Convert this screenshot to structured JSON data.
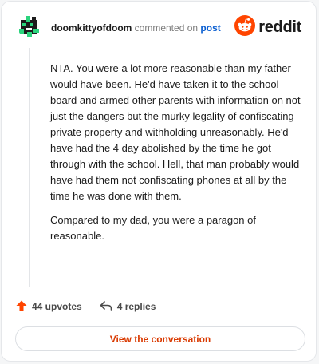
{
  "comment": {
    "author": "doomkittyofdoom",
    "action_text": "commented on",
    "post_link": "post",
    "paragraphs": [
      "NTA. You were a lot more reasonable than my father would have been. He'd have taken it to the school board and armed other parents with information on not just the dangers but the murky legality of confiscating private property and withholding unreasonably. He'd have had the 4 day abolished by the time he got through with the school. Hell, that man probably would have had them not confiscating phones at all by the time he was done with them.",
      "Compared to my dad, you were a paragon of reasonable."
    ]
  },
  "brand": {
    "name": "reddit",
    "accent_color": "#ff4500",
    "icon": "reddit-snoo-icon"
  },
  "stats": {
    "upvotes": "44 upvotes",
    "replies": "4 replies",
    "upvote_icon": "upvote-arrow-icon",
    "reply_icon": "reply-arrow-icon"
  },
  "cta": {
    "label": "View the conversation",
    "color": "#d93900"
  },
  "avatar": {
    "icon": "user-avatar-icon",
    "accent_color": "#2bd47d"
  }
}
